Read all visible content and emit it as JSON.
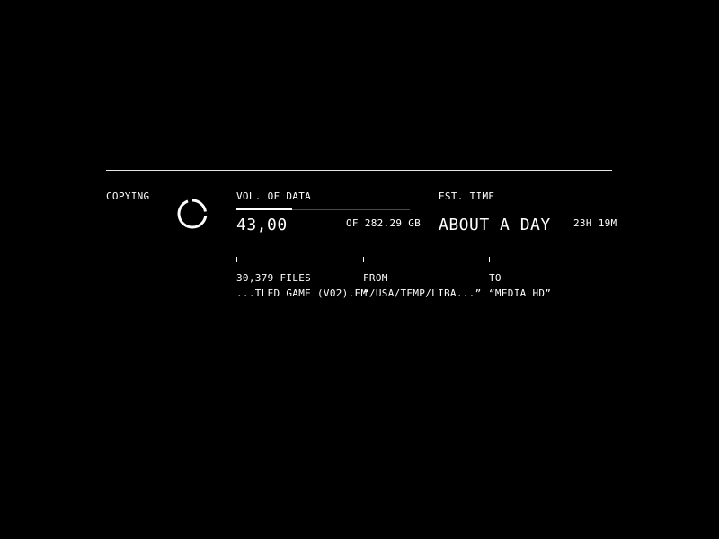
{
  "status": {
    "label": "COPYING"
  },
  "volume": {
    "label": "VOL. OF DATA",
    "value": "43,00",
    "total": "OF 282.29 GB",
    "progress_fraction": 0.32
  },
  "time": {
    "label": "EST. TIME",
    "value": "ABOUT A DAY",
    "exact": "23H 19M"
  },
  "details": {
    "files": {
      "label": "30,379 FILES",
      "value": "...TLED GAME (V02).FM"
    },
    "from": {
      "label": "FROM",
      "value": "“/USA/TEMP/LIBA...”"
    },
    "to": {
      "label": "TO",
      "value": "“MEDIA HD”"
    }
  },
  "icons": {
    "spinner": "spinner-icon"
  },
  "colors": {
    "background": "#000000",
    "foreground": "#ffffff",
    "track": "#4a4a4a"
  }
}
